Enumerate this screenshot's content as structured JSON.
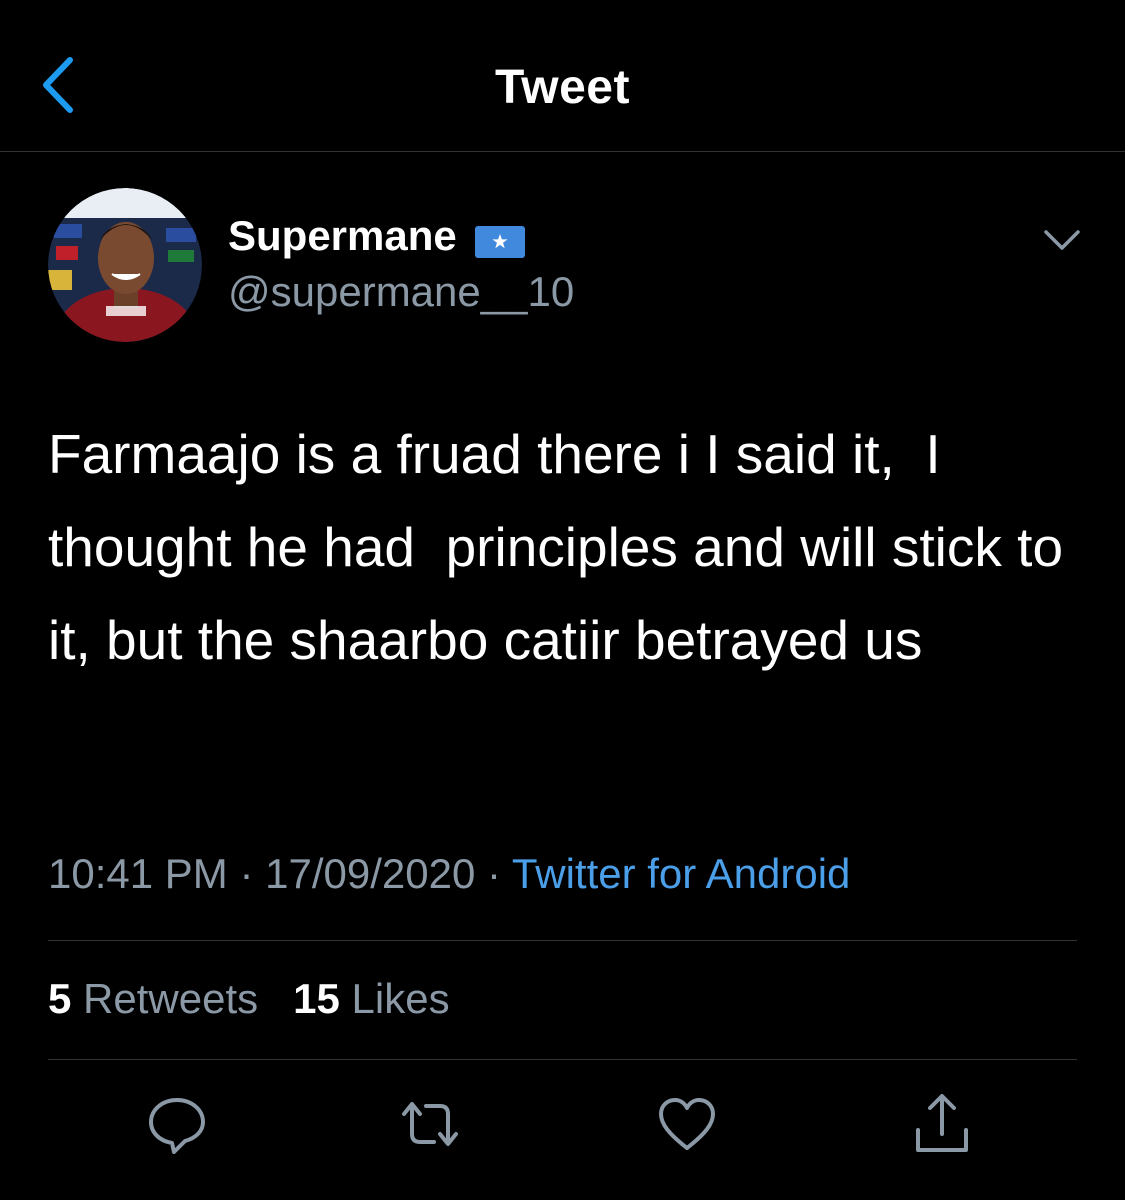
{
  "header": {
    "title": "Tweet",
    "back_icon": "chevron-left-icon"
  },
  "tweet": {
    "author": {
      "display_name": "Supermane",
      "handle": "@supermane__10",
      "flag_icon": "somalia-flag-icon"
    },
    "menu_icon": "chevron-down-icon",
    "text": "Farmaajo is a fruad there i I said it,  I thought he had  principles and will stick to it, but the shaarbo catiir betrayed us",
    "time": "10:41 PM",
    "separator": " · ",
    "date": "17/09/2020",
    "source": "Twitter for Android",
    "stats": {
      "retweets_count": "5",
      "retweets_label": "Retweets",
      "likes_count": "15",
      "likes_label": "Likes"
    }
  },
  "actions": [
    "reply-icon",
    "retweet-icon",
    "like-icon",
    "share-icon"
  ],
  "colors": {
    "background": "#000000",
    "text": "#ffffff",
    "secondary": "#8b98a5",
    "accent": "#1d9bf0",
    "divider": "#2f3336"
  }
}
